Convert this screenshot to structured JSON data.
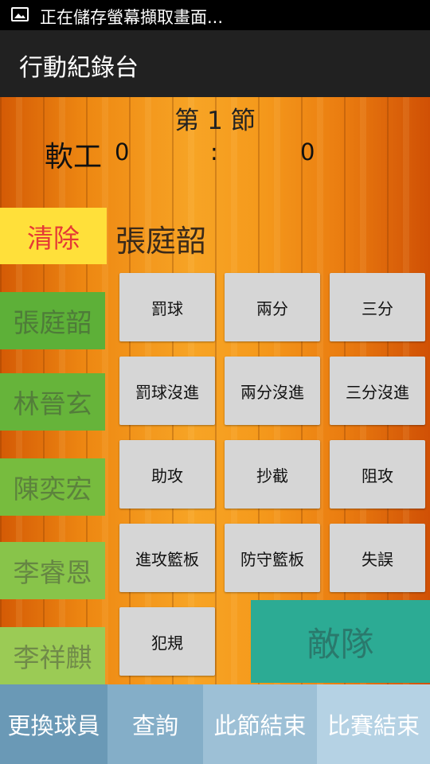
{
  "status_bar": {
    "notification_text": "正在儲存螢幕擷取畫面...",
    "icon": "image-icon"
  },
  "app_bar": {
    "title": "行動紀錄台"
  },
  "scoreboard": {
    "period": "第 1 節",
    "team": "軟工",
    "home_score": "0",
    "separator": ":",
    "away_score": "0"
  },
  "clear_label": "清除",
  "current_player": "張庭韶",
  "players": [
    "張庭韶",
    "林晉玄",
    "陳奕宏",
    "李睿恩",
    "李祥麒"
  ],
  "actions": {
    "free_throw": "罰球",
    "two_points": "兩分",
    "three_points": "三分",
    "free_throw_miss": "罰球沒進",
    "two_points_miss": "兩分沒進",
    "three_points_miss": "三分沒進",
    "assist": "助攻",
    "steal": "抄截",
    "block": "阻攻",
    "offensive_rebound": "進攻籃板",
    "defensive_rebound": "防守籃板",
    "turnover": "失誤",
    "foul": "犯規"
  },
  "opponent_label": "敵隊",
  "bottom_nav": [
    "更換球員",
    "查詢",
    "此節結束",
    "比賽結束"
  ],
  "colors": {
    "clear_bg": "#ffe03a",
    "clear_text": "#e53935",
    "opponent_bg": "#2cab94",
    "nav_bg": [
      "#6a99b6",
      "#84aec8",
      "#9dc0d6",
      "#b5d2e4"
    ]
  }
}
